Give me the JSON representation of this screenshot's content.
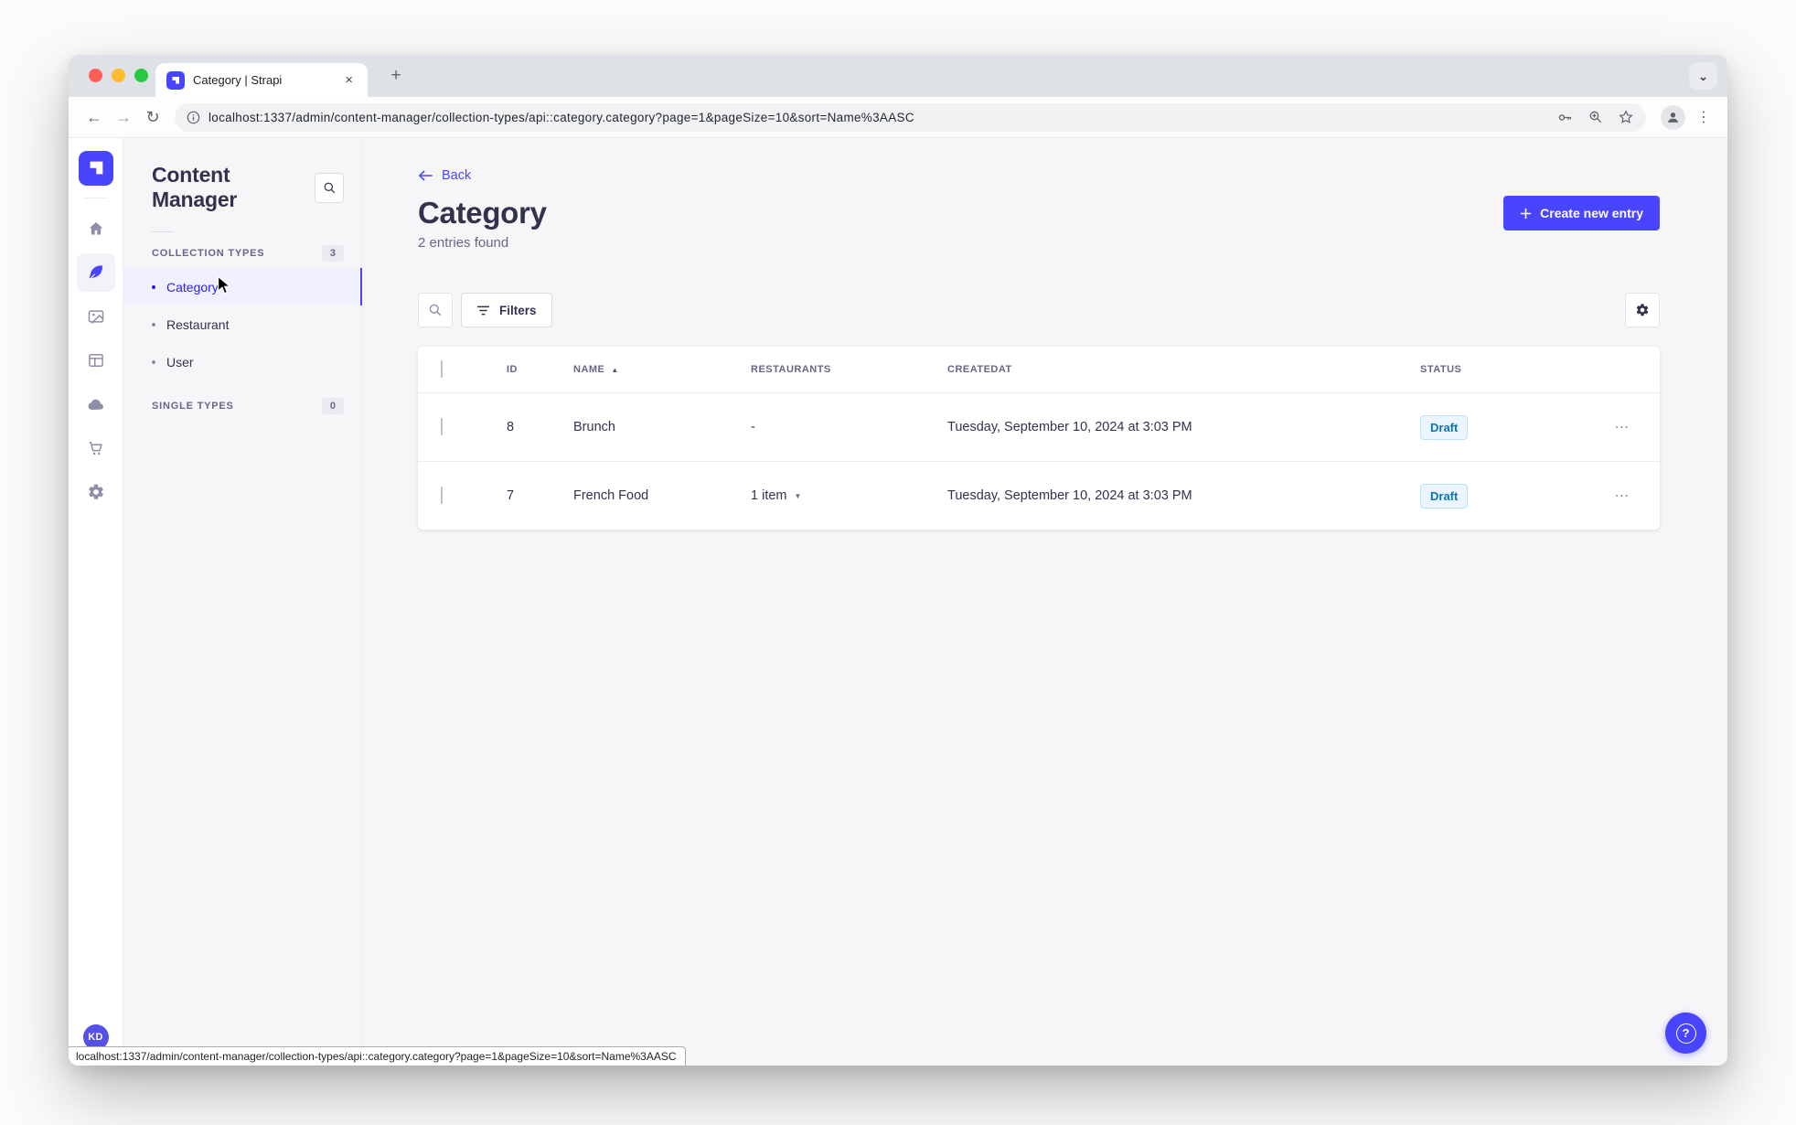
{
  "browser": {
    "tab_title": "Category | Strapi",
    "url": "localhost:1337/admin/content-manager/collection-types/api::category.category?page=1&pageSize=10&sort=Name%3AASC",
    "status_url": "localhost:1337/admin/content-manager/collection-types/api::category.category?page=1&pageSize=10&sort=Name%3AASC"
  },
  "icons": {
    "new_tab": "+",
    "close_tab": "×",
    "chevron_down": "⌄",
    "back_arrow": "←",
    "forward_arrow": "→",
    "reload": "↻",
    "kebab_vertical": "⋮",
    "sort_asc": "▲",
    "caret_down": "▼",
    "row_actions": "⋯",
    "help": "?"
  },
  "rail": {
    "items": [
      "home-icon",
      "content-manager-icon",
      "media-library-icon",
      "content-type-builder-icon",
      "cloud-icon",
      "marketplace-icon",
      "settings-icon"
    ],
    "active": "content-manager-icon"
  },
  "subnav": {
    "title": "Content Manager",
    "sections": [
      {
        "label": "COLLECTION TYPES",
        "count": "3",
        "items": [
          {
            "label": "Category",
            "active": true
          },
          {
            "label": "Restaurant",
            "active": false
          },
          {
            "label": "User",
            "active": false
          }
        ]
      },
      {
        "label": "SINGLE TYPES",
        "count": "0",
        "items": []
      }
    ]
  },
  "content": {
    "back": "Back",
    "title": "Category",
    "subtitle": "2 entries found",
    "create_button": "Create new entry",
    "filters_button": "Filters"
  },
  "table": {
    "columns": [
      "ID",
      "NAME",
      "RESTAURANTS",
      "CREATEDAT",
      "STATUS"
    ],
    "rows": [
      {
        "id": "8",
        "name": "Brunch",
        "restaurants": "-",
        "createdat": "Tuesday, September 10, 2024 at 3:03 PM",
        "status": "Draft"
      },
      {
        "id": "7",
        "name": "French Food",
        "restaurants": "1 item",
        "createdat": "Tuesday, September 10, 2024 at 3:03 PM",
        "status": "Draft"
      }
    ]
  },
  "user": {
    "initials": "KD"
  },
  "colors": {
    "accent": "#4945FF",
    "active_link": "#271FE0",
    "draft_bg": "#EAF5FF",
    "draft_border": "#B8E1FF",
    "draft_text": "#0C75AF",
    "traffic_red": "#FF5F57",
    "traffic_yellow": "#FEBC2E",
    "traffic_green": "#28C840"
  }
}
